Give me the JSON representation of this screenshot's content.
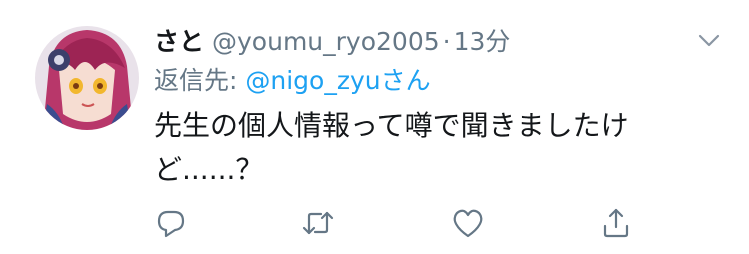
{
  "tweet": {
    "display_name": "さと",
    "handle": "@youmu_ryo2005",
    "separator": "·",
    "time": "13分",
    "reply_prefix": "返信先: ",
    "reply_mention": "@nigo_zyuさん",
    "text": "先生の個人情報って噂で聞きましたけ\nど......？"
  },
  "icons": {
    "caret": "chevron-down-icon",
    "reply": "comment-icon",
    "retweet": "retweet-icon",
    "like": "heart-icon",
    "share": "share-icon"
  },
  "colors": {
    "primary_text": "#14171a",
    "secondary_text": "#657786",
    "link": "#1da1f2",
    "icon": "#657786"
  }
}
